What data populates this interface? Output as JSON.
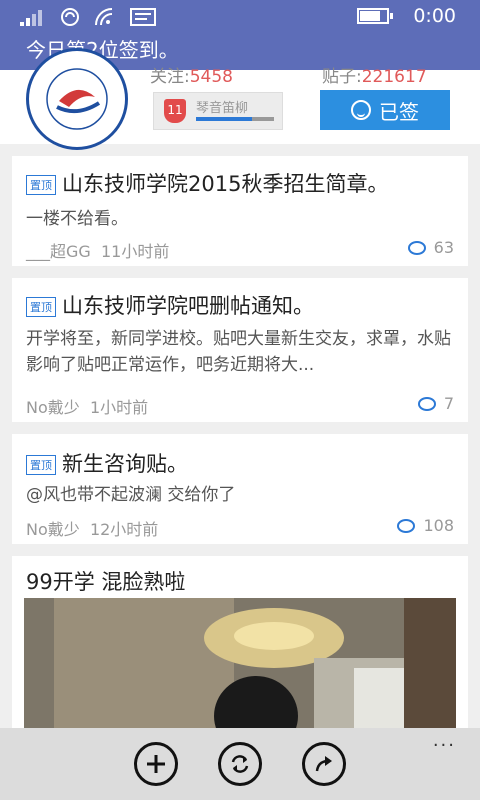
{
  "status_bar": {
    "time": "0:00"
  },
  "toast": {
    "text": "今日第2位签到。"
  },
  "header": {
    "follow_label": "关注:",
    "follow_count": "5458",
    "posts_label": "贴子:",
    "posts_count": "221617",
    "level_number": "11",
    "level_name": "琴音笛柳",
    "level_progress": 0.72,
    "signed_label": "已签"
  },
  "posts": [
    {
      "pinned": true,
      "pin_label": "置顶",
      "title": "山东技师学院2015秋季招生简章。",
      "body": "一楼不给看。",
      "author": "___超GG",
      "time": "11小时前",
      "comments": "63"
    },
    {
      "pinned": true,
      "pin_label": "置顶",
      "title": "山东技师学院吧删帖通知。",
      "body": "开学将至，新同学进校。贴吧大量新生交友，求罩，水贴影响了贴吧正常运作，吧务近期将大...",
      "author": "No戴少",
      "time": "1小时前",
      "comments": "7"
    },
    {
      "pinned": true,
      "pin_label": "置顶",
      "title": "新生咨询贴。",
      "body": "@风也带不起波澜 交给你了",
      "author": "No戴少",
      "time": "12小时前",
      "comments": "108"
    },
    {
      "pinned": false,
      "title": "99开学 混脸熟啦"
    }
  ],
  "app_bar": {
    "more": "..."
  },
  "colors": {
    "accent": "#5d6db8",
    "button_blue": "#2c8fe0",
    "count_red": "#e05a5a"
  },
  "icons": [
    "signal-icon",
    "data-icon",
    "wifi-icon",
    "message-icon",
    "battery-icon",
    "add-icon",
    "refresh-icon",
    "share-icon",
    "comment-icon",
    "smile-icon"
  ]
}
